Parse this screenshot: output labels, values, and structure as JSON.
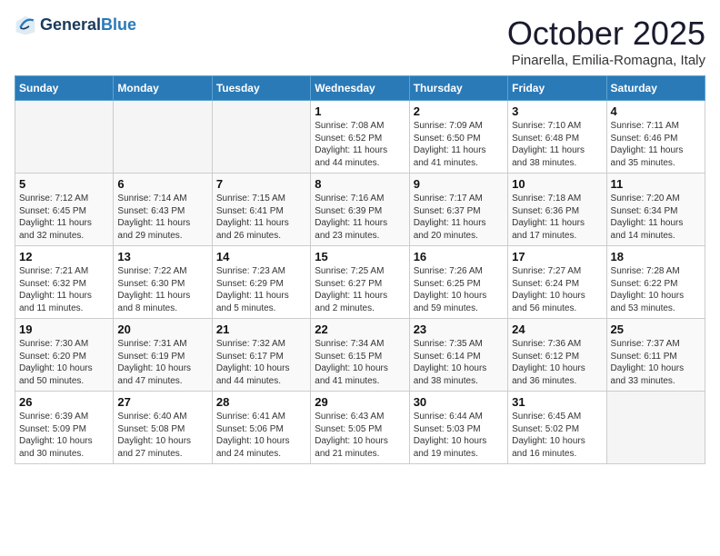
{
  "header": {
    "logo_line1": "General",
    "logo_line2": "Blue",
    "month": "October 2025",
    "location": "Pinarella, Emilia-Romagna, Italy"
  },
  "weekdays": [
    "Sunday",
    "Monday",
    "Tuesday",
    "Wednesday",
    "Thursday",
    "Friday",
    "Saturday"
  ],
  "weeks": [
    [
      {
        "day": "",
        "info": ""
      },
      {
        "day": "",
        "info": ""
      },
      {
        "day": "",
        "info": ""
      },
      {
        "day": "1",
        "info": "Sunrise: 7:08 AM\nSunset: 6:52 PM\nDaylight: 11 hours\nand 44 minutes."
      },
      {
        "day": "2",
        "info": "Sunrise: 7:09 AM\nSunset: 6:50 PM\nDaylight: 11 hours\nand 41 minutes."
      },
      {
        "day": "3",
        "info": "Sunrise: 7:10 AM\nSunset: 6:48 PM\nDaylight: 11 hours\nand 38 minutes."
      },
      {
        "day": "4",
        "info": "Sunrise: 7:11 AM\nSunset: 6:46 PM\nDaylight: 11 hours\nand 35 minutes."
      }
    ],
    [
      {
        "day": "5",
        "info": "Sunrise: 7:12 AM\nSunset: 6:45 PM\nDaylight: 11 hours\nand 32 minutes."
      },
      {
        "day": "6",
        "info": "Sunrise: 7:14 AM\nSunset: 6:43 PM\nDaylight: 11 hours\nand 29 minutes."
      },
      {
        "day": "7",
        "info": "Sunrise: 7:15 AM\nSunset: 6:41 PM\nDaylight: 11 hours\nand 26 minutes."
      },
      {
        "day": "8",
        "info": "Sunrise: 7:16 AM\nSunset: 6:39 PM\nDaylight: 11 hours\nand 23 minutes."
      },
      {
        "day": "9",
        "info": "Sunrise: 7:17 AM\nSunset: 6:37 PM\nDaylight: 11 hours\nand 20 minutes."
      },
      {
        "day": "10",
        "info": "Sunrise: 7:18 AM\nSunset: 6:36 PM\nDaylight: 11 hours\nand 17 minutes."
      },
      {
        "day": "11",
        "info": "Sunrise: 7:20 AM\nSunset: 6:34 PM\nDaylight: 11 hours\nand 14 minutes."
      }
    ],
    [
      {
        "day": "12",
        "info": "Sunrise: 7:21 AM\nSunset: 6:32 PM\nDaylight: 11 hours\nand 11 minutes."
      },
      {
        "day": "13",
        "info": "Sunrise: 7:22 AM\nSunset: 6:30 PM\nDaylight: 11 hours\nand 8 minutes."
      },
      {
        "day": "14",
        "info": "Sunrise: 7:23 AM\nSunset: 6:29 PM\nDaylight: 11 hours\nand 5 minutes."
      },
      {
        "day": "15",
        "info": "Sunrise: 7:25 AM\nSunset: 6:27 PM\nDaylight: 11 hours\nand 2 minutes."
      },
      {
        "day": "16",
        "info": "Sunrise: 7:26 AM\nSunset: 6:25 PM\nDaylight: 10 hours\nand 59 minutes."
      },
      {
        "day": "17",
        "info": "Sunrise: 7:27 AM\nSunset: 6:24 PM\nDaylight: 10 hours\nand 56 minutes."
      },
      {
        "day": "18",
        "info": "Sunrise: 7:28 AM\nSunset: 6:22 PM\nDaylight: 10 hours\nand 53 minutes."
      }
    ],
    [
      {
        "day": "19",
        "info": "Sunrise: 7:30 AM\nSunset: 6:20 PM\nDaylight: 10 hours\nand 50 minutes."
      },
      {
        "day": "20",
        "info": "Sunrise: 7:31 AM\nSunset: 6:19 PM\nDaylight: 10 hours\nand 47 minutes."
      },
      {
        "day": "21",
        "info": "Sunrise: 7:32 AM\nSunset: 6:17 PM\nDaylight: 10 hours\nand 44 minutes."
      },
      {
        "day": "22",
        "info": "Sunrise: 7:34 AM\nSunset: 6:15 PM\nDaylight: 10 hours\nand 41 minutes."
      },
      {
        "day": "23",
        "info": "Sunrise: 7:35 AM\nSunset: 6:14 PM\nDaylight: 10 hours\nand 38 minutes."
      },
      {
        "day": "24",
        "info": "Sunrise: 7:36 AM\nSunset: 6:12 PM\nDaylight: 10 hours\nand 36 minutes."
      },
      {
        "day": "25",
        "info": "Sunrise: 7:37 AM\nSunset: 6:11 PM\nDaylight: 10 hours\nand 33 minutes."
      }
    ],
    [
      {
        "day": "26",
        "info": "Sunrise: 6:39 AM\nSunset: 5:09 PM\nDaylight: 10 hours\nand 30 minutes."
      },
      {
        "day": "27",
        "info": "Sunrise: 6:40 AM\nSunset: 5:08 PM\nDaylight: 10 hours\nand 27 minutes."
      },
      {
        "day": "28",
        "info": "Sunrise: 6:41 AM\nSunset: 5:06 PM\nDaylight: 10 hours\nand 24 minutes."
      },
      {
        "day": "29",
        "info": "Sunrise: 6:43 AM\nSunset: 5:05 PM\nDaylight: 10 hours\nand 21 minutes."
      },
      {
        "day": "30",
        "info": "Sunrise: 6:44 AM\nSunset: 5:03 PM\nDaylight: 10 hours\nand 19 minutes."
      },
      {
        "day": "31",
        "info": "Sunrise: 6:45 AM\nSunset: 5:02 PM\nDaylight: 10 hours\nand 16 minutes."
      },
      {
        "day": "",
        "info": ""
      }
    ]
  ]
}
